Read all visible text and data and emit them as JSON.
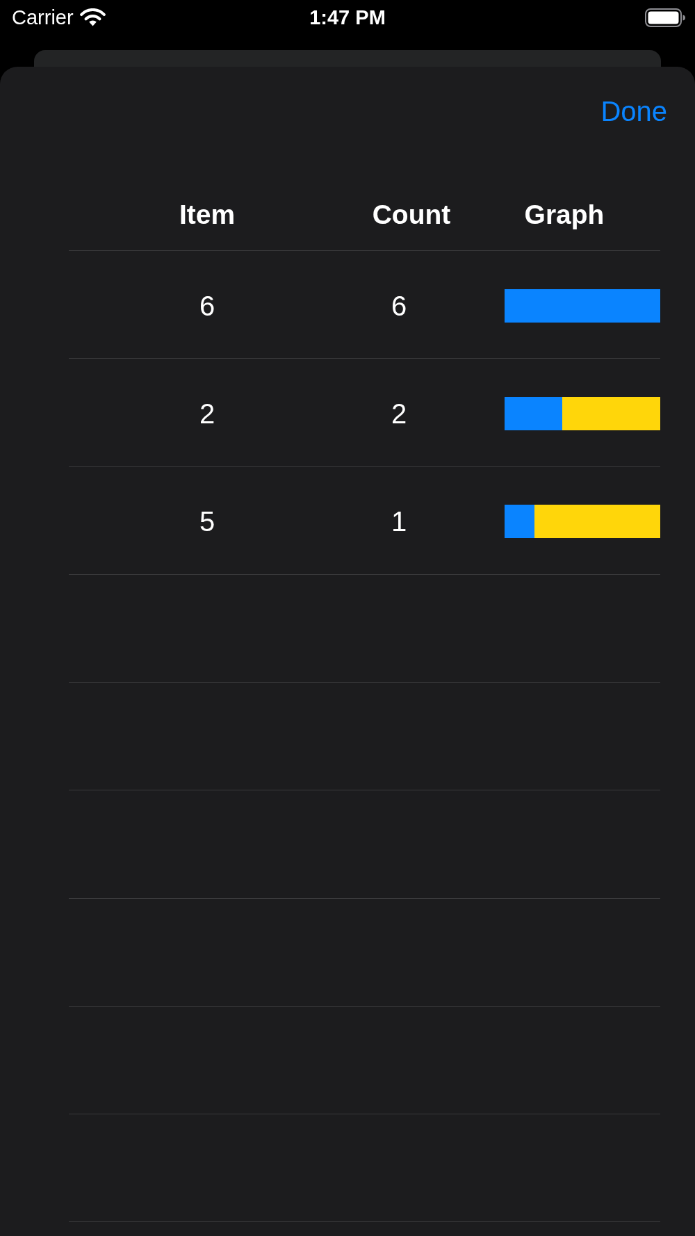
{
  "status_bar": {
    "carrier": "Carrier",
    "time": "1:47 PM"
  },
  "nav": {
    "done": "Done"
  },
  "table": {
    "columns": [
      "Item",
      "Count",
      "Graph"
    ],
    "rows": [
      {
        "item": "6",
        "count": "6",
        "level": 1
      },
      {
        "item": "2",
        "count": "2",
        "level": 0.37
      },
      {
        "item": "5",
        "count": "1",
        "level": 0.19
      }
    ]
  }
}
